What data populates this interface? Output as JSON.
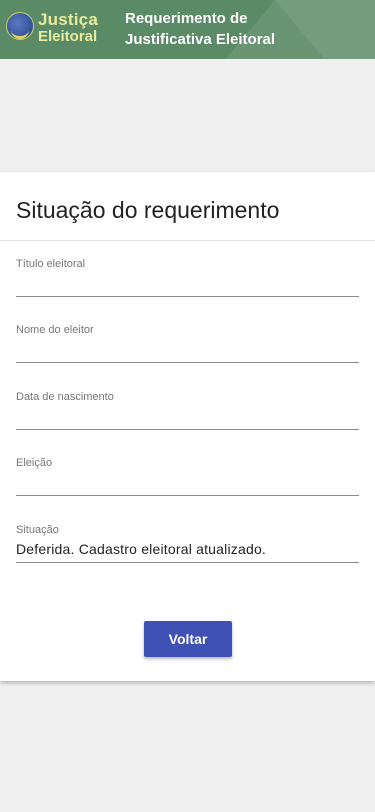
{
  "header": {
    "logo_line1": "Justiça",
    "logo_line2": "Eleitoral",
    "title_line1": "Requerimento de",
    "title_line2": "Justificativa Eleitoral"
  },
  "card": {
    "title": "Situação do requerimento",
    "fields": [
      {
        "label": "Título eleitoral",
        "value": ""
      },
      {
        "label": "Nome do eleitor",
        "value": ""
      },
      {
        "label": "Data de nascimento",
        "value": ""
      },
      {
        "label": "Eleição",
        "value": ""
      },
      {
        "label": "Situação",
        "value": "Deferida. Cadastro eleitoral atualizado."
      }
    ],
    "back_button": "Voltar"
  },
  "colors": {
    "header_bg": "#5a8a66",
    "button_bg": "#3f51b5",
    "logo_text": "#e8ec9a"
  }
}
